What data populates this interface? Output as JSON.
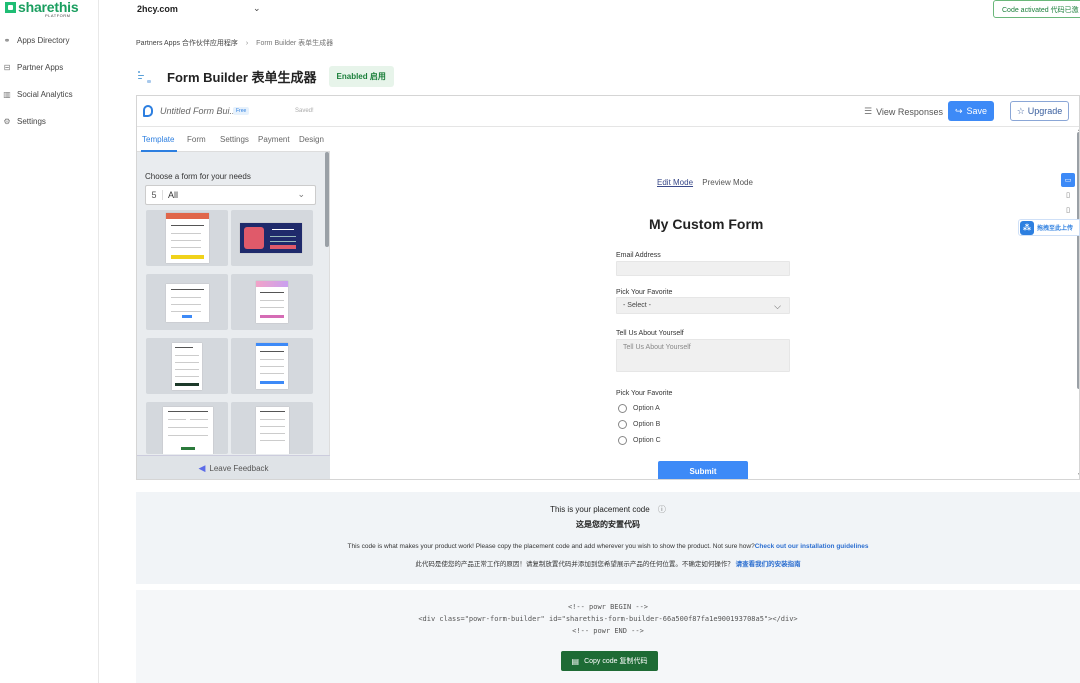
{
  "sidebar": {
    "logo_text": "sharethis",
    "logo_sub": "PLATFORM",
    "items": [
      {
        "label": "Apps Directory",
        "icon": "⚭"
      },
      {
        "label": "Partner Apps",
        "icon": "⊟"
      },
      {
        "label": "Social Analytics",
        "icon": "▥"
      },
      {
        "label": "Settings",
        "icon": "⚙"
      }
    ]
  },
  "topbar": {
    "site": "2hcy.com",
    "site_chevron": "⌄",
    "code_status": "Code activated 代码已激"
  },
  "breadcrumb": {
    "parent": "Partners Apps 合作伙伴应用程序",
    "separator": "›",
    "current": "Form Builder 表单生成器"
  },
  "page": {
    "title": "Form Builder 表单生成器",
    "badge": "Enabled 启用"
  },
  "builder": {
    "form_name": "Untitled Form Bui...",
    "plan_badge": "Free",
    "save_status": "Saved!",
    "view_responses": "View Responses",
    "view_icon": "☰",
    "save_label": "Save",
    "save_icon": "↪",
    "upgrade_label": "Upgrade",
    "upgrade_icon": "☆",
    "tabs": [
      "Template",
      "Form",
      "Settings",
      "Payment",
      "Design"
    ],
    "choose_label": "Choose a form for your needs",
    "filter_count": "5",
    "filter_value": "All",
    "filter_chevron": "⌄",
    "feedback_label": "Leave Feedback",
    "feedback_icon": "◀",
    "mode_edit": "Edit Mode",
    "mode_preview": "Preview Mode",
    "device_icons": [
      "▭",
      "▯",
      "▯"
    ],
    "scroll_up": "▲",
    "scroll_down": "▼"
  },
  "form": {
    "title": "My Custom Form",
    "email_label": "Email Address",
    "email_value": "",
    "pick_label": "Pick Your Favorite",
    "pick_value": "- Select -",
    "pick_chevron": "⌵",
    "about_label": "Tell Us About Yourself",
    "about_placeholder": "Tell Us About Yourself",
    "radio_label": "Pick Your Favorite",
    "options": [
      "Option A",
      "Option B",
      "Option C"
    ],
    "submit": "Submit"
  },
  "float_upload": {
    "label": "拖拽至此上传",
    "icon": "⁂"
  },
  "placement": {
    "title": "This is your placement code",
    "title_icon": "ⓘ",
    "title_cn": "这是您的安置代码",
    "desc": "This code is what makes your product work! Please copy the placement code and add wherever you wish to show the product. Not sure how?",
    "desc_link": "Check out our installation guidelines",
    "desc_cn": "此代码是使您的产品正常工作的原因！请复制放置代码并添加到您希望展示产品的任何位置。不确定如何操作？",
    "desc_cn_link": "请查看我们的安装指南",
    "code_begin": "<!-- powr BEGIN -->",
    "code_div": "<div class=\"powr-form-builder\" id=\"sharethis-form-builder-66a500f87fa1e900193708a5\"></div>",
    "code_end": "<!-- powr END -->",
    "copy_label": "Copy code 复制代码",
    "copy_icon": "▤"
  },
  "colors": {
    "brand_green": "#1fbd74",
    "primary_blue": "#3d8af7",
    "copy_green": "#1e6b35"
  }
}
